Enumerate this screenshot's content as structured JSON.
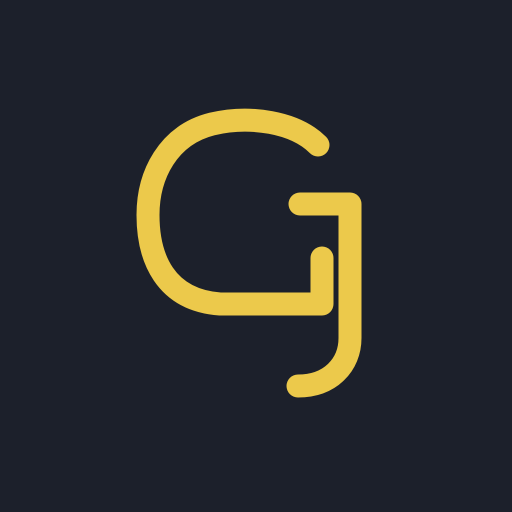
{
  "logo": {
    "text": "GJ",
    "icon": "gj-monogram-icon",
    "foreground_color": "#ecc94b",
    "background_color": "#1c202b"
  }
}
